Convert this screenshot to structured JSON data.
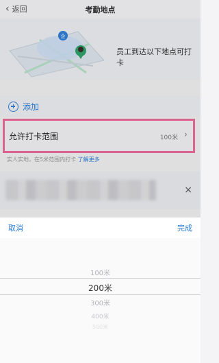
{
  "nav": {
    "back_label": "返回",
    "title": "考勤地点"
  },
  "hero": {
    "description": "员工到达以下地点可打卡",
    "logo_char": "企"
  },
  "add_location": {
    "label": "添加"
  },
  "range_setting": {
    "label": "允许打卡范围",
    "value": "100米"
  },
  "hint": {
    "text": "实人实地，在5米范围内打卡",
    "link": "了解更多"
  },
  "sheet": {
    "cancel_label": "取消",
    "done_label": "完成",
    "options": [
      "100米",
      "200米",
      "300米",
      "400米",
      "500米"
    ],
    "selected": "200米"
  },
  "colors": {
    "accent": "#2f80d8",
    "highlight_border": "#ec6b9b"
  }
}
